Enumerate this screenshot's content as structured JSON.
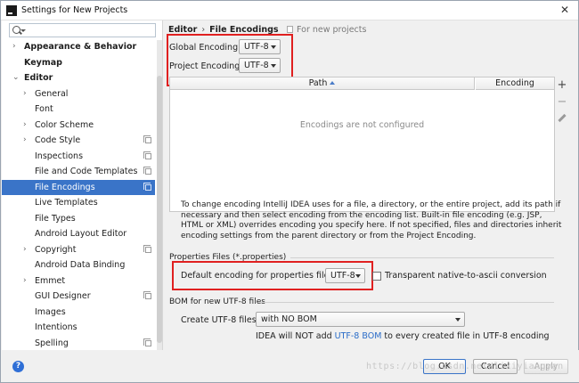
{
  "window": {
    "title": "Settings for New Projects",
    "close_glyph": "✕"
  },
  "search": {
    "placeholder": ""
  },
  "sidebar": {
    "items": [
      {
        "label": "Appearance & Behavior",
        "bold": true,
        "arrow": "›",
        "level": 0
      },
      {
        "label": "Keymap",
        "bold": true,
        "arrow": "",
        "level": 0
      },
      {
        "label": "Editor",
        "bold": true,
        "arrow": "⌄",
        "level": 0
      },
      {
        "label": "General",
        "arrow": "›",
        "level": 1
      },
      {
        "label": "Font",
        "arrow": "",
        "level": 1
      },
      {
        "label": "Color Scheme",
        "arrow": "›",
        "level": 1
      },
      {
        "label": "Code Style",
        "arrow": "›",
        "level": 1,
        "copy": true
      },
      {
        "label": "Inspections",
        "arrow": "",
        "level": 1,
        "copy": true
      },
      {
        "label": "File and Code Templates",
        "arrow": "",
        "level": 1,
        "copy": true
      },
      {
        "label": "File Encodings",
        "arrow": "",
        "level": 1,
        "copy": true,
        "selected": true
      },
      {
        "label": "Live Templates",
        "arrow": "",
        "level": 1
      },
      {
        "label": "File Types",
        "arrow": "",
        "level": 1
      },
      {
        "label": "Android Layout Editor",
        "arrow": "",
        "level": 1
      },
      {
        "label": "Copyright",
        "arrow": "›",
        "level": 1,
        "copy": true
      },
      {
        "label": "Android Data Binding",
        "arrow": "",
        "level": 1
      },
      {
        "label": "Emmet",
        "arrow": "›",
        "level": 1
      },
      {
        "label": "GUI Designer",
        "arrow": "",
        "level": 1,
        "copy": true
      },
      {
        "label": "Images",
        "arrow": "",
        "level": 1
      },
      {
        "label": "Intentions",
        "arrow": "",
        "level": 1
      },
      {
        "label": "Spelling",
        "arrow": "",
        "level": 1,
        "copy": true
      }
    ]
  },
  "breadcrumb": {
    "parent": "Editor",
    "separator": "›",
    "current": "File Encodings",
    "note": "For new projects"
  },
  "encodings": {
    "global_label": "Global Encoding:",
    "global_value": "UTF-8",
    "project_label": "Project Encoding:",
    "project_value": "UTF-8"
  },
  "table": {
    "col_path": "Path",
    "col_encoding": "Encoding",
    "empty_text": "Encodings are not configured",
    "add_glyph": "+",
    "remove_glyph": "−"
  },
  "description": "To change encoding IntelliJ IDEA uses for a file, a directory, or the entire project, add its path if necessary and then select encoding from the encoding list. Built-in file encoding (e.g. JSP, HTML or XML) overrides encoding you specify here. If not specified, files and directories inherit encoding settings from the parent directory or from the Project Encoding.",
  "properties": {
    "section_title": "Properties Files (*.properties)",
    "default_label": "Default encoding for properties files:",
    "default_value": "UTF-8",
    "native_label": "Transparent native-to-ascii conversion"
  },
  "bom": {
    "section_title": "BOM for new UTF-8 files",
    "create_label": "Create UTF-8 files:",
    "create_value": "with NO BOM",
    "info_prefix": "IDEA will NOT add ",
    "info_link": "UTF-8 BOM",
    "info_suffix": " to every created file in UTF-8 encoding"
  },
  "footer": {
    "help": "?",
    "ok": "OK",
    "cancel": "Cancel",
    "apply": "Apply"
  },
  "watermark": "https://blog.csdn.net/lixiyiangyan"
}
